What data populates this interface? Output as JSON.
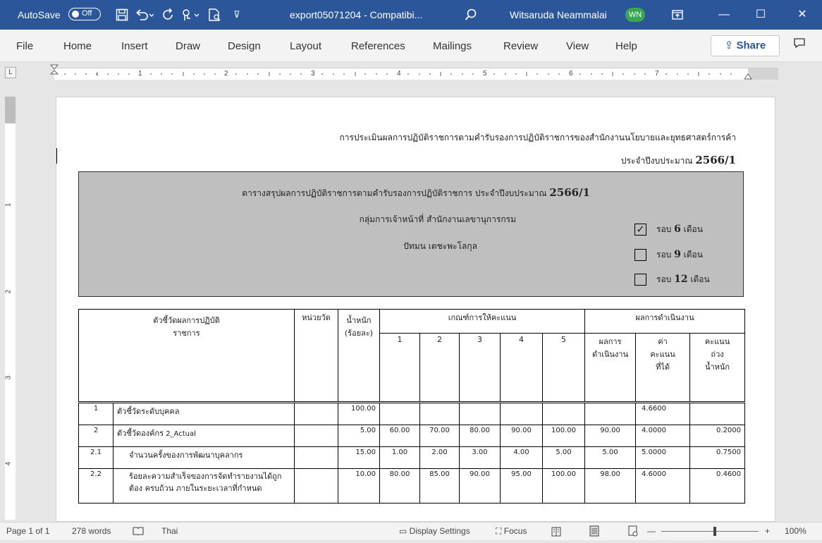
{
  "titlebar": {
    "autosave_label": "AutoSave",
    "autosave_state": "Off",
    "save_icon": "save-icon",
    "undo_icon": "undo-icon",
    "redo_icon": "redo-icon",
    "doc_title": "export05071204  -  Compatibi...",
    "user_name": "Witsaruda Neammalai",
    "user_initials": "WN",
    "minimize_glyph": "—",
    "restore_glyph": "☐",
    "close_glyph": "✕"
  },
  "ribbon": {
    "tabs": [
      "File",
      "Home",
      "Insert",
      "Draw",
      "Design",
      "Layout",
      "References",
      "Mailings",
      "Review",
      "View",
      "Help"
    ],
    "share_label": "Share"
  },
  "ruler": {
    "numbers": [
      "1",
      "2",
      "3",
      "4",
      "5",
      "6",
      "7"
    ]
  },
  "vruler": {
    "numbers": [
      "1",
      "2",
      "3",
      "4"
    ]
  },
  "document": {
    "header_line1": "การประเมินผลการปฏิบัติราชการตามคำรับรองการปฏิบัติราชการของสำนักงานนโยบายและยุทธศาสตร์การค้า",
    "header_line2_prefix": "ประจำปีงบประมาณ ",
    "header_line2_year": "2566/1",
    "box": {
      "title_prefix": "ตารางสรุปผลการปฏิบัติราชการตามคำรับรองการปฏิบัติราชการ   ประจำปีงบประมาณ ",
      "title_year": "2566/1",
      "line2": "กลุ่มการเจ้าหน้าที่   สำนักงานเลขานุการกรม",
      "line3": "ปัทมน เตชะพะโลกุล",
      "rounds": [
        {
          "checked": true,
          "prefix": "รอบ ",
          "num": "6",
          "suffix": " เดือน"
        },
        {
          "checked": false,
          "prefix": "รอบ ",
          "num": "9",
          "suffix": " เดือน"
        },
        {
          "checked": false,
          "prefix": "รอบ ",
          "num": "12",
          "suffix": " เดือน"
        }
      ]
    },
    "table": {
      "h_indicator_1": "ตัวชี้วัดผลการปฏิบัติ",
      "h_indicator_2": "ราชการ",
      "h_unit": "หน่วยวัด",
      "h_weight_1": "น้ำหนัก",
      "h_weight_2": "(ร้อยละ)",
      "h_criteria": "เกณฑ์การให้คะแนน",
      "h_levels": [
        "1",
        "2",
        "3",
        "4",
        "5"
      ],
      "h_results": "ผลการดำเนินงาน",
      "h_result_1a": "ผลการ",
      "h_result_1b": "ดำเนินงาน",
      "h_result_2a": "ค่า",
      "h_result_2b": "คะแนน",
      "h_result_2c": "ที่ได้",
      "h_result_3a": "คะแนน",
      "h_result_3b": "ถ่วง",
      "h_result_3c": "น้ำหนัก",
      "rows": [
        {
          "no": "1",
          "name": "ตัวชี้วัดระดับบุคคล",
          "sub": "",
          "unit": "",
          "weight": "100.00",
          "l1": "",
          "l2": "",
          "l3": "",
          "l4": "",
          "l5": "",
          "result": "",
          "score": "4.6600",
          "weighted": ""
        },
        {
          "no": "2",
          "name": "ตัวชี้วัดองค์กร",
          "sub": " 2_Actual",
          "unit": "",
          "weight": "5.00",
          "l1": "60.00",
          "l2": "70.00",
          "l3": "80.00",
          "l4": "90.00",
          "l5": "100.00",
          "result": "90.00",
          "score": "4.0000",
          "weighted": "0.2000"
        },
        {
          "no": "2.1",
          "name": "จำนวนครั้งของการพัฒนาบุคลากร",
          "sub": "",
          "unit": "",
          "weight": "15.00",
          "l1": "1.00",
          "l2": "2.00",
          "l3": "3.00",
          "l4": "4.00",
          "l5": "5.00",
          "result": "5.00",
          "score": "5.0000",
          "weighted": "0.7500"
        },
        {
          "no": "2.2",
          "name": "ร้อยละความสำเร็จของการจัดทำรายงานได้ถูกต้อง ครบถ้วน ภายในระยะเวลาที่กำหนด",
          "sub": "",
          "unit": "",
          "weight": "10.00",
          "l1": "80.00",
          "l2": "85.00",
          "l3": "90.00",
          "l4": "95.00",
          "l5": "100.00",
          "result": "98.00",
          "score": "4.6000",
          "weighted": "0.4600"
        }
      ]
    }
  },
  "statusbar": {
    "page": "Page 1 of 1",
    "words": "278 words",
    "language": "Thai",
    "display_settings": "Display Settings",
    "focus": "Focus",
    "zoom_minus": "—",
    "zoom_plus": "+",
    "zoom": "100%"
  }
}
